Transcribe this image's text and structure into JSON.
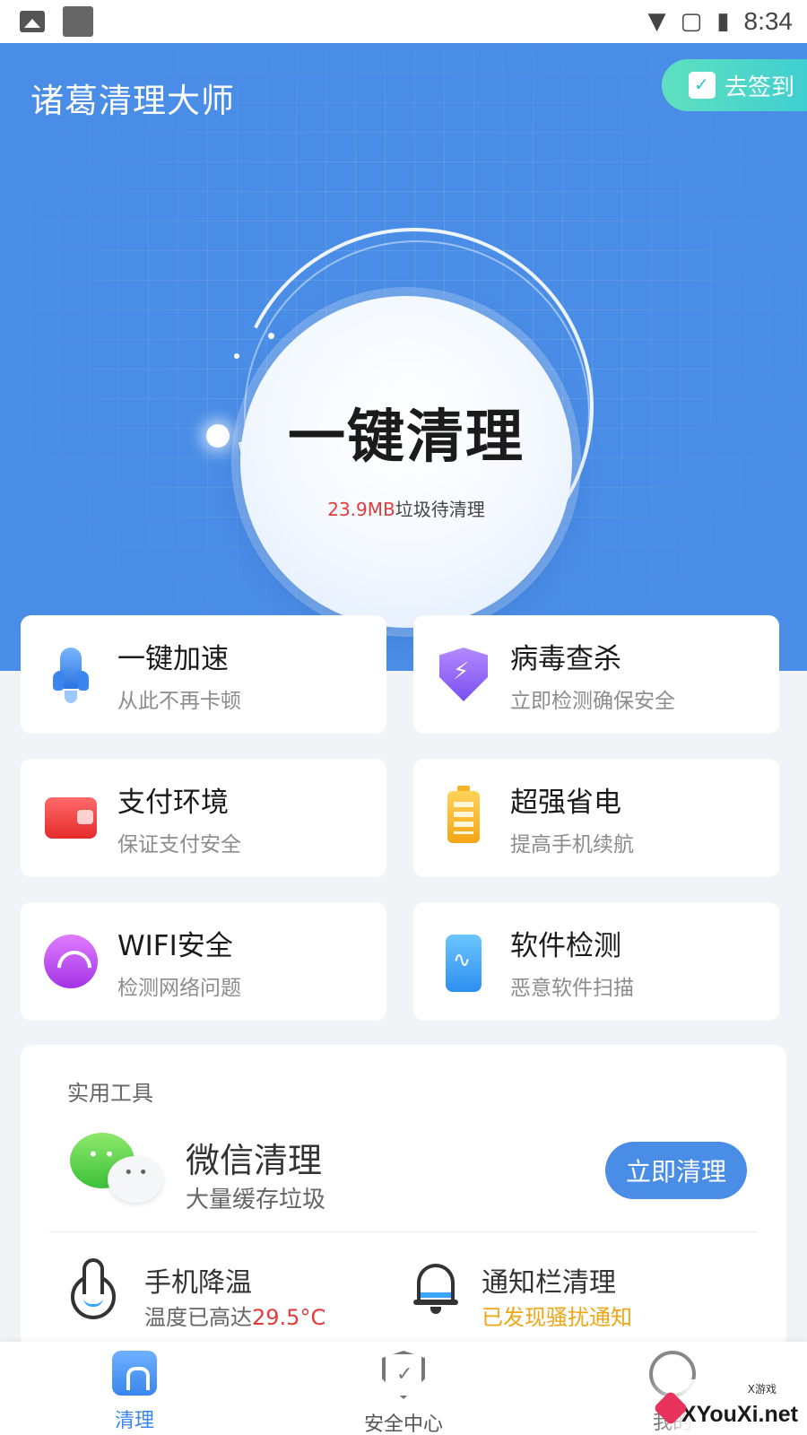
{
  "status_bar": {
    "time": "8:34"
  },
  "header": {
    "app_title": "诸葛清理大师",
    "signin_label": "去签到"
  },
  "hero": {
    "title": "一键清理",
    "junk_amount": "23.9MB",
    "junk_suffix": "垃圾待清理"
  },
  "features": [
    {
      "title": "一键加速",
      "subtitle": "从此不再卡顿",
      "icon": "rocket-icon"
    },
    {
      "title": "病毒查杀",
      "subtitle": "立即检测确保安全",
      "icon": "shield-bolt-icon"
    },
    {
      "title": "支付环境",
      "subtitle": "保证支付安全",
      "icon": "wallet-icon"
    },
    {
      "title": "超强省电",
      "subtitle": "提高手机续航",
      "icon": "battery-icon"
    },
    {
      "title": "WIFI安全",
      "subtitle": "检测网络问题",
      "icon": "wifi-icon"
    },
    {
      "title": "软件检测",
      "subtitle": "恶意软件扫描",
      "icon": "phone-scan-icon"
    }
  ],
  "tools": {
    "section_label": "实用工具",
    "wechat": {
      "title": "微信清理",
      "subtitle": "大量缓存垃圾",
      "button": "立即清理"
    },
    "cooling": {
      "title": "手机降温",
      "subtitle_prefix": "温度已高达",
      "temperature": "29.5°C"
    },
    "notification": {
      "title": "通知栏清理",
      "subtitle": "已发现骚扰通知"
    }
  },
  "bottom_nav": {
    "items": [
      {
        "label": "清理",
        "active": true
      },
      {
        "label": "安全中心",
        "active": false
      },
      {
        "label": "我的",
        "active": false
      }
    ]
  },
  "watermark": {
    "text": "XYouXi.net",
    "small": "X游戏"
  },
  "colors": {
    "primary": "#4a8de6",
    "accent_red": "#e33b3b",
    "accent_orange": "#f0a514",
    "signin": "#4fd8c8"
  }
}
